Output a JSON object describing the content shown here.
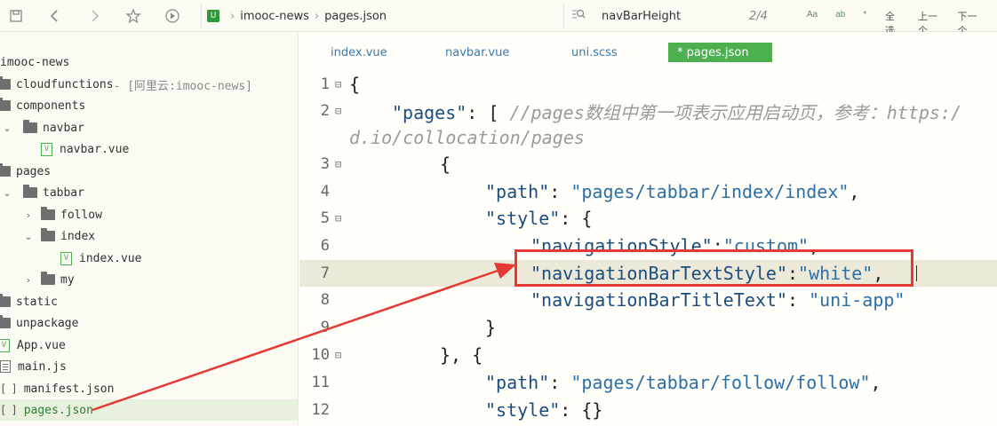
{
  "toolbar": {
    "icons": [
      "save-icon",
      "back-icon",
      "forward-icon",
      "star-icon",
      "run-icon"
    ],
    "breadcrumb": [
      "imooc-news",
      "pages.json"
    ],
    "search": {
      "value": "navBarHeight",
      "count": "2/4",
      "options": [
        "Aa",
        "ab",
        "*"
      ],
      "select_all": "全选",
      "prev": "上一个",
      "next": "下一个"
    }
  },
  "sidebar": {
    "project": "imooc-news",
    "items": [
      {
        "label": "cloudfunctions",
        "annotation": " - [阿里云:imooc-news]"
      },
      {
        "label": "components"
      },
      {
        "label": "navbar"
      },
      {
        "label": "navbar.vue"
      },
      {
        "label": "pages"
      },
      {
        "label": "tabbar"
      },
      {
        "label": "follow"
      },
      {
        "label": "index"
      },
      {
        "label": "index.vue"
      },
      {
        "label": "my"
      },
      {
        "label": "static"
      },
      {
        "label": "unpackage"
      },
      {
        "label": "App.vue"
      },
      {
        "label": "main.js"
      },
      {
        "label": "manifest.json"
      },
      {
        "label": "pages.json"
      }
    ]
  },
  "editor": {
    "tabs": [
      {
        "label": "index.vue",
        "active": false
      },
      {
        "label": "navbar.vue",
        "active": false
      },
      {
        "label": "uni.scss",
        "active": false
      },
      {
        "label": "* pages.json",
        "active": true
      }
    ],
    "lines": [
      {
        "n": "1",
        "t": "{"
      },
      {
        "n": "2",
        "key": "\"pages\"",
        "t2": ": [ ",
        "comment": "//pages数组中第一项表示应用启动页，参考：https:/"
      },
      {
        "n": "",
        "comment": "d.io/collocation/pages"
      },
      {
        "n": "3",
        "t": "{"
      },
      {
        "n": "4",
        "key": "\"path\"",
        "t2": ": ",
        "val": "\"pages/tabbar/index/index\"",
        "t3": ","
      },
      {
        "n": "5",
        "key": "\"style\"",
        "t2": ": {"
      },
      {
        "n": "6",
        "key": "\"navigationStyle\"",
        "t2": ":",
        "val": "\"custom\"",
        "t3": ","
      },
      {
        "n": "7",
        "key": "\"navigationBarTextStyle\"",
        "t2": ":",
        "val": "\"white\"",
        "t3": ","
      },
      {
        "n": "8",
        "key": "\"navigationBarTitleText\"",
        "t2": ": ",
        "val": "\"uni-app\""
      },
      {
        "n": "9",
        "t": "}"
      },
      {
        "n": "10",
        "t": "}, {"
      },
      {
        "n": "11",
        "key": "\"path\"",
        "t2": ": ",
        "val": "\"pages/tabbar/follow/follow\"",
        "t3": ","
      },
      {
        "n": "12",
        "key": "\"style\"",
        "t2": ": {}"
      }
    ]
  },
  "colors": {
    "accent": "#4caf50",
    "annotation_red": "#e53935",
    "string_blue": "#2b6fa8"
  }
}
